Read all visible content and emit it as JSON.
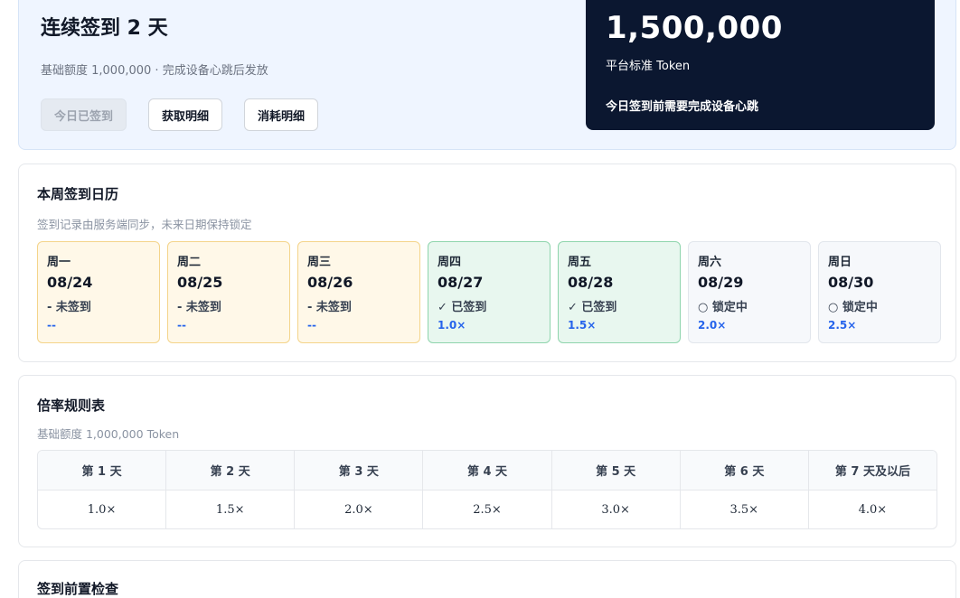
{
  "hero": {
    "title": "连续签到 2 天",
    "subtitle": "基础额度 1,000,000 · 完成设备心跳后发放",
    "buttons": {
      "signed_today": "今日已签到",
      "earn_detail": "获取明细",
      "spend_detail": "消耗明细"
    },
    "reward": {
      "amount": "1,500,000",
      "unit": "平台标准 Token",
      "note": "今日签到前需要完成设备心跳"
    }
  },
  "calendar": {
    "title": "本周签到日历",
    "subtitle": "签到记录由服务端同步，未来日期保持锁定",
    "days": [
      {
        "week": "周一",
        "date": "08/24",
        "status": "- 未签到",
        "multiplier": "--"
      },
      {
        "week": "周二",
        "date": "08/25",
        "status": "- 未签到",
        "multiplier": "--"
      },
      {
        "week": "周三",
        "date": "08/26",
        "status": "- 未签到",
        "multiplier": "--"
      },
      {
        "week": "周四",
        "date": "08/27",
        "status": "✓ 已签到",
        "multiplier": "1.0×"
      },
      {
        "week": "周五",
        "date": "08/28",
        "status": "✓ 已签到",
        "multiplier": "1.5×"
      },
      {
        "week": "周六",
        "date": "08/29",
        "status": "○ 锁定中",
        "multiplier": "2.0×"
      },
      {
        "week": "周日",
        "date": "08/30",
        "status": "○ 锁定中",
        "multiplier": "2.5×"
      }
    ]
  },
  "rules": {
    "title": "倍率规则表",
    "subtitle": "基础额度 1,000,000 Token",
    "headers": [
      "第 1 天",
      "第 2 天",
      "第 3 天",
      "第 4 天",
      "第 5 天",
      "第 6 天",
      "第 7 天及以后"
    ],
    "values": [
      "1.0×",
      "1.5×",
      "2.0×",
      "2.5×",
      "3.0×",
      "3.5×",
      "4.0×"
    ]
  },
  "precheck": {
    "title": "签到前置检查"
  }
}
